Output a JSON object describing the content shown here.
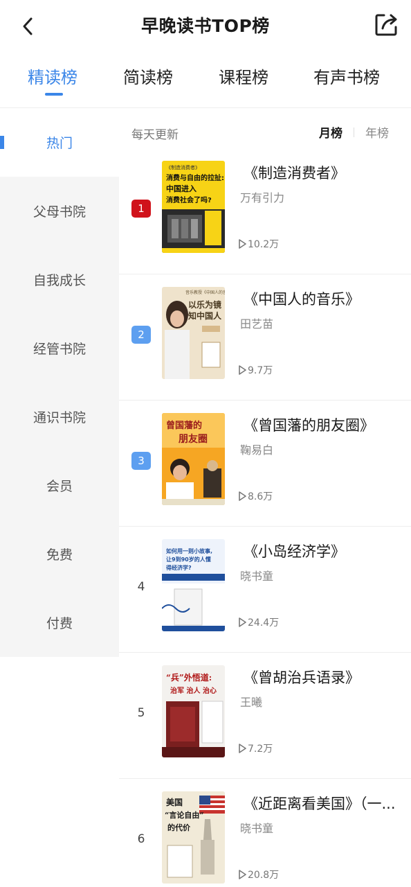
{
  "header": {
    "title": "早晚读书TOP榜",
    "back_icon": "chevron-left-icon",
    "share_icon": "share-icon"
  },
  "tabs": [
    {
      "label": "精读榜",
      "active": true
    },
    {
      "label": "简读榜",
      "active": false
    },
    {
      "label": "课程榜",
      "active": false
    },
    {
      "label": "有声书榜",
      "active": false
    }
  ],
  "sidebar": {
    "items": [
      {
        "label": "热门",
        "active": true
      },
      {
        "label": "父母书院",
        "active": false
      },
      {
        "label": "自我成长",
        "active": false
      },
      {
        "label": "经管书院",
        "active": false
      },
      {
        "label": "通识书院",
        "active": false
      },
      {
        "label": "会员",
        "active": false
      },
      {
        "label": "免费",
        "active": false
      },
      {
        "label": "付费",
        "active": false
      }
    ]
  },
  "list": {
    "update_text": "每天更新",
    "period": {
      "month": "月榜",
      "year": "年榜",
      "selected": "月榜"
    },
    "books": [
      {
        "rank": "1",
        "title": "《制造消费者》",
        "author": "万有引力",
        "plays": "10.2万",
        "cover_text": [
          "消费与自由的拉扯:",
          "中国进入",
          "消费社会了吗?"
        ]
      },
      {
        "rank": "2",
        "title": "《中国人的音乐》",
        "author": "田艺苗",
        "plays": "9.7万",
        "cover_text": [
          "以乐为镜",
          "知中国人"
        ]
      },
      {
        "rank": "3",
        "title": "《曾国藩的朋友圈》",
        "author": "鞠易白",
        "plays": "8.6万",
        "cover_text": [
          "曾国藩的",
          "朋友圈"
        ]
      },
      {
        "rank": "4",
        "title": "《小岛经济学》",
        "author": "晓书童",
        "plays": "24.4万",
        "cover_text": [
          "如何用一则小故事,",
          "让9到90岁的人懂",
          "得经济学?"
        ]
      },
      {
        "rank": "5",
        "title": "《曾胡治兵语录》",
        "author": "王曦",
        "plays": "7.2万",
        "cover_text": [
          "“兵”外悟道:",
          "治军 治人 治心"
        ]
      },
      {
        "rank": "6",
        "title": "《近距离看美国》（一...",
        "author": "晓书童",
        "plays": "20.8万",
        "cover_text": [
          "美国",
          "“言论自由”",
          "的代价"
        ]
      }
    ]
  },
  "colors": {
    "accent": "#3b86e8",
    "rank1": "#d0121b",
    "rank_badge": "#5d9ff0"
  }
}
